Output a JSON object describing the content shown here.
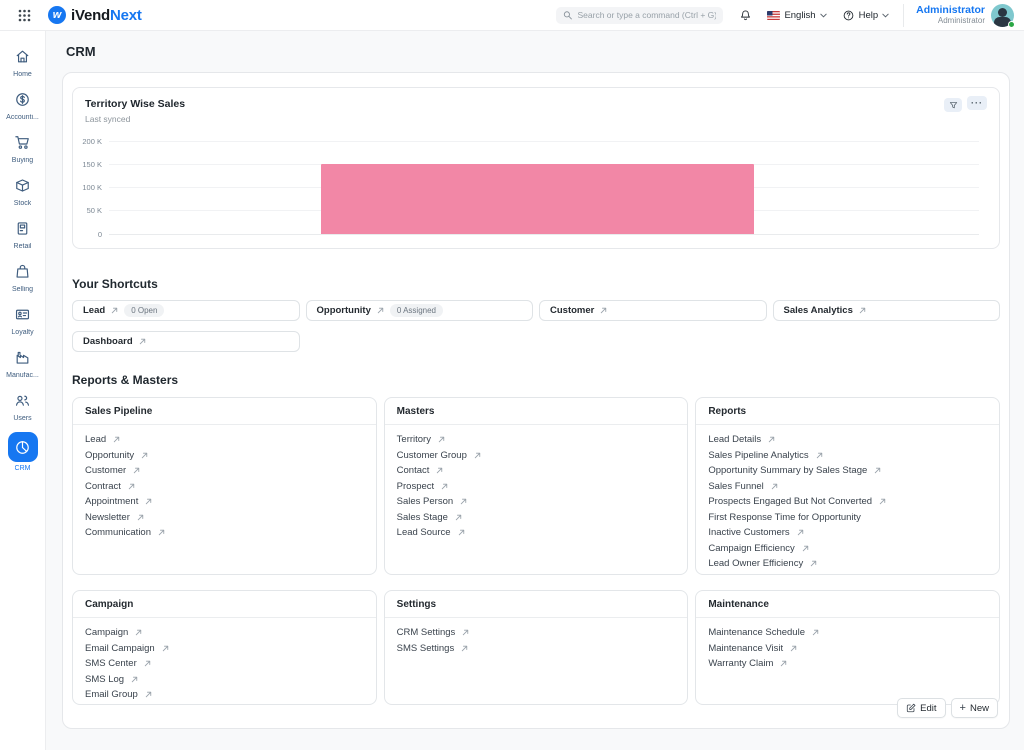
{
  "header": {
    "logo_text_dark": "iVend",
    "logo_text_blue": "Next",
    "search_placeholder": "Search or type a command (Ctrl + G)",
    "language_label": "English",
    "help_label": "Help",
    "user_name": "Administrator",
    "user_role": "Administrator"
  },
  "icons": {
    "ellipsis_glyph": "···",
    "plus_glyph": "+"
  },
  "colors": {
    "brand_blue": "#1677F1",
    "bar_pink": "#F287A6",
    "sidebar_icon": "#3E5C7E"
  },
  "page": {
    "title": "CRM"
  },
  "sidebar": {
    "items": [
      {
        "label": "Home",
        "icon": "home-icon",
        "active": false
      },
      {
        "label": "Accounti...",
        "icon": "accounting-icon",
        "active": false
      },
      {
        "label": "Buying",
        "icon": "buying-icon",
        "active": false
      },
      {
        "label": "Stock",
        "icon": "stock-icon",
        "active": false
      },
      {
        "label": "Retail",
        "icon": "retail-icon",
        "active": false
      },
      {
        "label": "Selling",
        "icon": "selling-icon",
        "active": false
      },
      {
        "label": "Loyalty",
        "icon": "loyalty-icon",
        "active": false
      },
      {
        "label": "Manufac...",
        "icon": "manufacturing-icon",
        "active": false
      },
      {
        "label": "Users",
        "icon": "users-icon",
        "active": false
      },
      {
        "label": "CRM",
        "icon": "crm-icon",
        "active": true
      }
    ]
  },
  "chart_card": {
    "title": "Territory Wise Sales",
    "subtitle": "Last synced"
  },
  "chart_data": {
    "type": "bar",
    "title": "Territory Wise Sales",
    "categories": [
      ""
    ],
    "values": [
      150000
    ],
    "y_ticks": [
      "200 K",
      "150 K",
      "100 K",
      "50 K",
      "0"
    ],
    "ylim": [
      0,
      200000
    ],
    "bar_color": "#F287A6",
    "grid": true,
    "legend": false
  },
  "shortcuts": {
    "heading": "Your Shortcuts",
    "items": [
      {
        "label": "Lead",
        "badge": "0 Open"
      },
      {
        "label": "Opportunity",
        "badge": "0 Assigned"
      },
      {
        "label": "Customer",
        "badge": ""
      },
      {
        "label": "Sales Analytics",
        "badge": ""
      },
      {
        "label": "Dashboard",
        "badge": ""
      }
    ]
  },
  "reports_masters": {
    "heading": "Reports & Masters",
    "cards": [
      {
        "title": "Sales Pipeline",
        "links": [
          {
            "label": "Lead",
            "arrow": true
          },
          {
            "label": "Opportunity",
            "arrow": true
          },
          {
            "label": "Customer",
            "arrow": true
          },
          {
            "label": "Contract",
            "arrow": true
          },
          {
            "label": "Appointment",
            "arrow": true
          },
          {
            "label": "Newsletter",
            "arrow": true
          },
          {
            "label": "Communication",
            "arrow": true
          }
        ]
      },
      {
        "title": "Masters",
        "links": [
          {
            "label": "Territory",
            "arrow": true
          },
          {
            "label": "Customer Group",
            "arrow": true
          },
          {
            "label": "Contact",
            "arrow": true
          },
          {
            "label": "Prospect",
            "arrow": true
          },
          {
            "label": "Sales Person",
            "arrow": true
          },
          {
            "label": "Sales Stage",
            "arrow": true
          },
          {
            "label": "Lead Source",
            "arrow": true
          }
        ]
      },
      {
        "title": "Reports",
        "links": [
          {
            "label": "Lead Details",
            "arrow": true
          },
          {
            "label": "Sales Pipeline Analytics",
            "arrow": true
          },
          {
            "label": "Opportunity Summary by Sales Stage",
            "arrow": true
          },
          {
            "label": "Sales Funnel",
            "arrow": true
          },
          {
            "label": "Prospects Engaged But Not Converted",
            "arrow": true
          },
          {
            "label": "First Response Time for Opportunity",
            "arrow": false
          },
          {
            "label": "Inactive Customers",
            "arrow": true
          },
          {
            "label": "Campaign Efficiency",
            "arrow": true
          },
          {
            "label": "Lead Owner Efficiency",
            "arrow": true
          }
        ]
      },
      {
        "title": "Campaign",
        "links": [
          {
            "label": "Campaign",
            "arrow": true
          },
          {
            "label": "Email Campaign",
            "arrow": true
          },
          {
            "label": "SMS Center",
            "arrow": true
          },
          {
            "label": "SMS Log",
            "arrow": true
          },
          {
            "label": "Email Group",
            "arrow": true
          }
        ]
      },
      {
        "title": "Settings",
        "links": [
          {
            "label": "CRM Settings",
            "arrow": true
          },
          {
            "label": "SMS Settings",
            "arrow": true
          }
        ]
      },
      {
        "title": "Maintenance",
        "links": [
          {
            "label": "Maintenance Schedule",
            "arrow": true
          },
          {
            "label": "Maintenance Visit",
            "arrow": true
          },
          {
            "label": "Warranty Claim",
            "arrow": true
          }
        ]
      }
    ]
  },
  "footer": {
    "edit_label": "Edit",
    "new_label": "New"
  }
}
